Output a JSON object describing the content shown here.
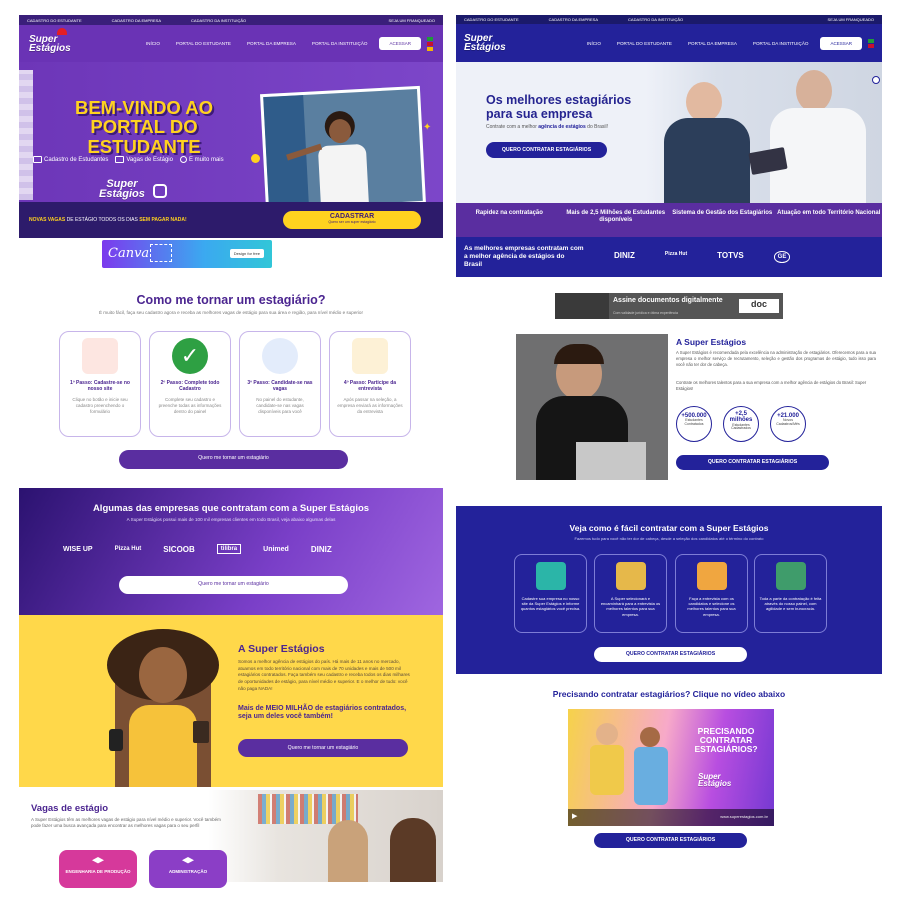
{
  "left": {
    "topbar": [
      "CADASTRO DO ESTUDANTE",
      "CADASTRO DA EMPRESA",
      "CADASTRO DA INSTITUIÇÃO",
      "SEJA UM FRANQUEADO"
    ],
    "logo": [
      "Super",
      "Estágios"
    ],
    "nav": [
      "INÍCIO",
      "PORTAL DO ESTUDANTE",
      "PORTAL DA EMPRESA",
      "PORTAL DA INSTITUIÇÃO"
    ],
    "access": "ACESSAR",
    "hero_title": "BEM-VINDO AO PORTAL DO ESTUDANTE",
    "hero_items": [
      "Cadastro de Estudantes",
      "Vagas de Estágio",
      "E muito mais"
    ],
    "news_pre": "NOVAS VAGAS",
    "news_mid": " DE ESTÁGIO TODOS OS DIAS ",
    "news_post": "SEM PAGAR NADA!",
    "register": "CADASTRAR",
    "register_sub": "Quero ser um super estagiário",
    "canva": {
      "word": "Canva",
      "btn": "Design for free"
    },
    "how_title": "Como me tornar um estagiário?",
    "how_sub": "É muito fácil, faça seu cadastro agora e receba as melhores vagas de estágio para sua área e região, para nível médio e superior",
    "steps": [
      {
        "t": "1º Passo: Cadastre-se no nosso site",
        "d": "Clique no botão e inicie seu cadastro preenchendo o formulário",
        "color": "#e85d4a"
      },
      {
        "t": "2º Passo: Complete todo Cadastro",
        "d": "Complete seu cadastro e preenche todas as informações dentro do painel",
        "color": "#2ea043"
      },
      {
        "t": "3º Passo: Candidate-se nas vagas",
        "d": "No painel do estudante, candidate-se nas vagas disponíveis para você",
        "color": "#3a6fd8"
      },
      {
        "t": "4º Passo: Participe da entrevista",
        "d": "Após passar na seleção, a empresa enviará as informações da entrevista",
        "color": "#f0b429"
      }
    ],
    "cta": "Quero me tornar um estagiário",
    "companies_title": "Algumas das empresas que contratam com a Super Estágios",
    "companies_sub": "A Super Estágios possui mais de 100 mil empresas clientes em todo Brasil, veja abaixo algumas delas",
    "company_logos": [
      "WISE UP",
      "Pizza Hut",
      "SICOOB",
      "tilibra",
      "Unimed",
      "DINIZ"
    ],
    "about_title": "A Super Estágios",
    "about_text": "Somos a melhor agência de estágios do país. Há mais de 11 anos no mercado, atuamos em todo território nacional com mais de 70 unidades e mais de 500 mil estagiários contratados. Faça também seu cadastro e receba todos os dias milhares de oportunidades de estágio, para nível médio e superior. E o melhor de tudo: você não paga NADA!",
    "about_highlight": "Mais de MEIO MILHÃO de estagiários contratados, seja um deles você também!",
    "vagas_title": "Vagas de estágio",
    "vagas_text": "A Super Estágios têm as melhores vagas de estágio para nível médio e superior. Você também pode fazer uma busca avançada para encontrar as melhores vagas para o seu perfil",
    "vagas_buttons": [
      "ENGENHARIA DE PRODUÇÃO",
      "ADMINISTRAÇÃO"
    ]
  },
  "right": {
    "topbar": [
      "CADASTRO DO ESTUDANTE",
      "CADASTRO DA EMPRESA",
      "CADASTRO DA INSTITUIÇÃO",
      "SEJA UM FRANQUEADO"
    ],
    "nav": [
      "INÍCIO",
      "PORTAL DO ESTUDANTE",
      "PORTAL DA EMPRESA",
      "PORTAL DA INSTITUIÇÃO"
    ],
    "access": "ACESSAR",
    "hero_title": "Os melhores estagiários para sua empresa",
    "hero_pre": "Contrate com a melhor ",
    "hero_bold": "agência de estágios",
    "hero_post": " do Brasil!",
    "cta": "QUERO CONTRATAR ESTAGIÁRIOS",
    "stats": [
      "Rapidez na contratação",
      "Mais de 2,5 Milhões de Estudantes disponíveis",
      "Sistema de Gestão dos Estagiários",
      "Atuação em todo Território Nacional"
    ],
    "partners_text": "As melhores empresas contratam com a melhor agência de estágios do Brasil",
    "partner_logos": [
      "DINIZ",
      "Pizza Hut",
      "TOTVS",
      "GE"
    ],
    "ad": {
      "title": "Assine documentos digitalmente",
      "sub": "Com validade jurídica e ótima experiência",
      "brand": "doc"
    },
    "about_title": "A Super Estágios",
    "about_text": "A Super Estágios é recomendada pela excelência na administração de estagiários. Oferecemos para a sua empresa o melhor serviço de recrutamento, seleção e gestão dos programas de estágio, tudo isso para você não ter dor de cabeça.",
    "about_text2": "Contrate os melhores talentos para a sua empresa com a melhor agência de estágios do Brasil: Super Estágios!",
    "circles": [
      {
        "n": "+500.000",
        "s": "Estudantes Contratados"
      },
      {
        "n": "+2,5 milhões",
        "s": "Estudantes Cadastrados"
      },
      {
        "n": "+21.000",
        "s": "Novos Cadastros/Mês"
      }
    ],
    "how_title": "Veja como é fácil contratar com a Super Estágios",
    "how_sub": "Fazemos tudo para você não ter dor de cabeça, desde a seleção dos candidatos até o término do contrato",
    "how_cards": [
      {
        "d": "Cadastre sua empresa no nosso site da Super Estágios e informe quantos estagiários você precisa.",
        "color": "#2bb5a8"
      },
      {
        "d": "A Super selecionará e encaminhará para a entrevista os melhores talentos para sua empresa.",
        "color": "#e6b84a"
      },
      {
        "d": "Faça a entrevista com os candidatos e selecione os melhores talentos para sua empresa.",
        "color": "#f0a640"
      },
      {
        "d": "Toda a parte da contratação é feita através do nosso painel, com agilidade e sem burocracia.",
        "color": "#3f9c6b"
      }
    ],
    "video_title": "Precisando contratar estagiários? Clique no vídeo abaixo",
    "video_overlay": "PRECISANDO CONTRATAR ESTAGIÁRIOS?",
    "video_url": "www.superestagios.com.br"
  }
}
